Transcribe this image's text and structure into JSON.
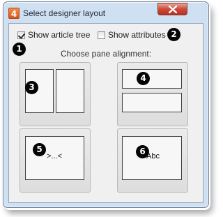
{
  "window": {
    "app_icon_glyph": "4",
    "title": "Select designer layout",
    "close_icon": "close-icon"
  },
  "options": {
    "show_article_tree": {
      "label": "Show article tree",
      "checked": true
    },
    "show_attributes": {
      "label": "Show attributes",
      "checked": false
    }
  },
  "subtitle": "Choose pane alignment:",
  "callouts": [
    "1",
    "2",
    "3",
    "4",
    "5",
    "6"
  ],
  "layouts": {
    "vertical_split": {
      "label": ""
    },
    "horizontal_split": {
      "label": ""
    },
    "xml_source": {
      "label": ">...<"
    },
    "text_view": {
      "label": "Abc"
    }
  }
}
